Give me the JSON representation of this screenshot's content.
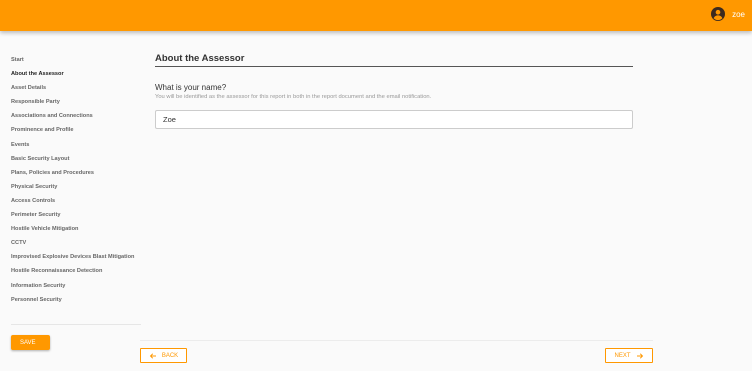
{
  "header": {
    "username": "zoe",
    "icons": {
      "avatar": "account-circle-icon"
    },
    "color": "#ff9800"
  },
  "sidebar": {
    "items": [
      {
        "label": "Start",
        "active": false
      },
      {
        "label": "About the Assessor",
        "active": true
      },
      {
        "label": "Asset Details",
        "active": false
      },
      {
        "label": "Responsible Party",
        "active": false
      },
      {
        "label": "Associations and Connections",
        "active": false
      },
      {
        "label": "Prominence and Profile",
        "active": false
      },
      {
        "label": "Events",
        "active": false
      },
      {
        "label": "Basic Security Layout",
        "active": false
      },
      {
        "label": "Plans, Policies and Procedures",
        "active": false
      },
      {
        "label": "Physical Security",
        "active": false
      },
      {
        "label": "Access Controls",
        "active": false
      },
      {
        "label": "Perimeter Security",
        "active": false
      },
      {
        "label": "Hostile Vehicle Mitigation",
        "active": false
      },
      {
        "label": "CCTV",
        "active": false
      },
      {
        "label": "Improvised Explosive Devices Blast Mitigation",
        "active": false
      },
      {
        "label": "Hostile Reconnaissance Detection",
        "active": false
      },
      {
        "label": "Information Security",
        "active": false
      },
      {
        "label": "Personnel Security",
        "active": false
      }
    ],
    "save_label": "SAVE"
  },
  "main": {
    "title": "About the Assessor",
    "question": "What is your name?",
    "hint": "You will be identified as the assessor for this report in both in the report document and the email notification.",
    "name_value": "Zoe"
  },
  "footer": {
    "back_label": "BACK",
    "next_label": "NEXT",
    "icons": {
      "back": "arrow-left-icon",
      "next": "arrow-right-icon"
    }
  }
}
